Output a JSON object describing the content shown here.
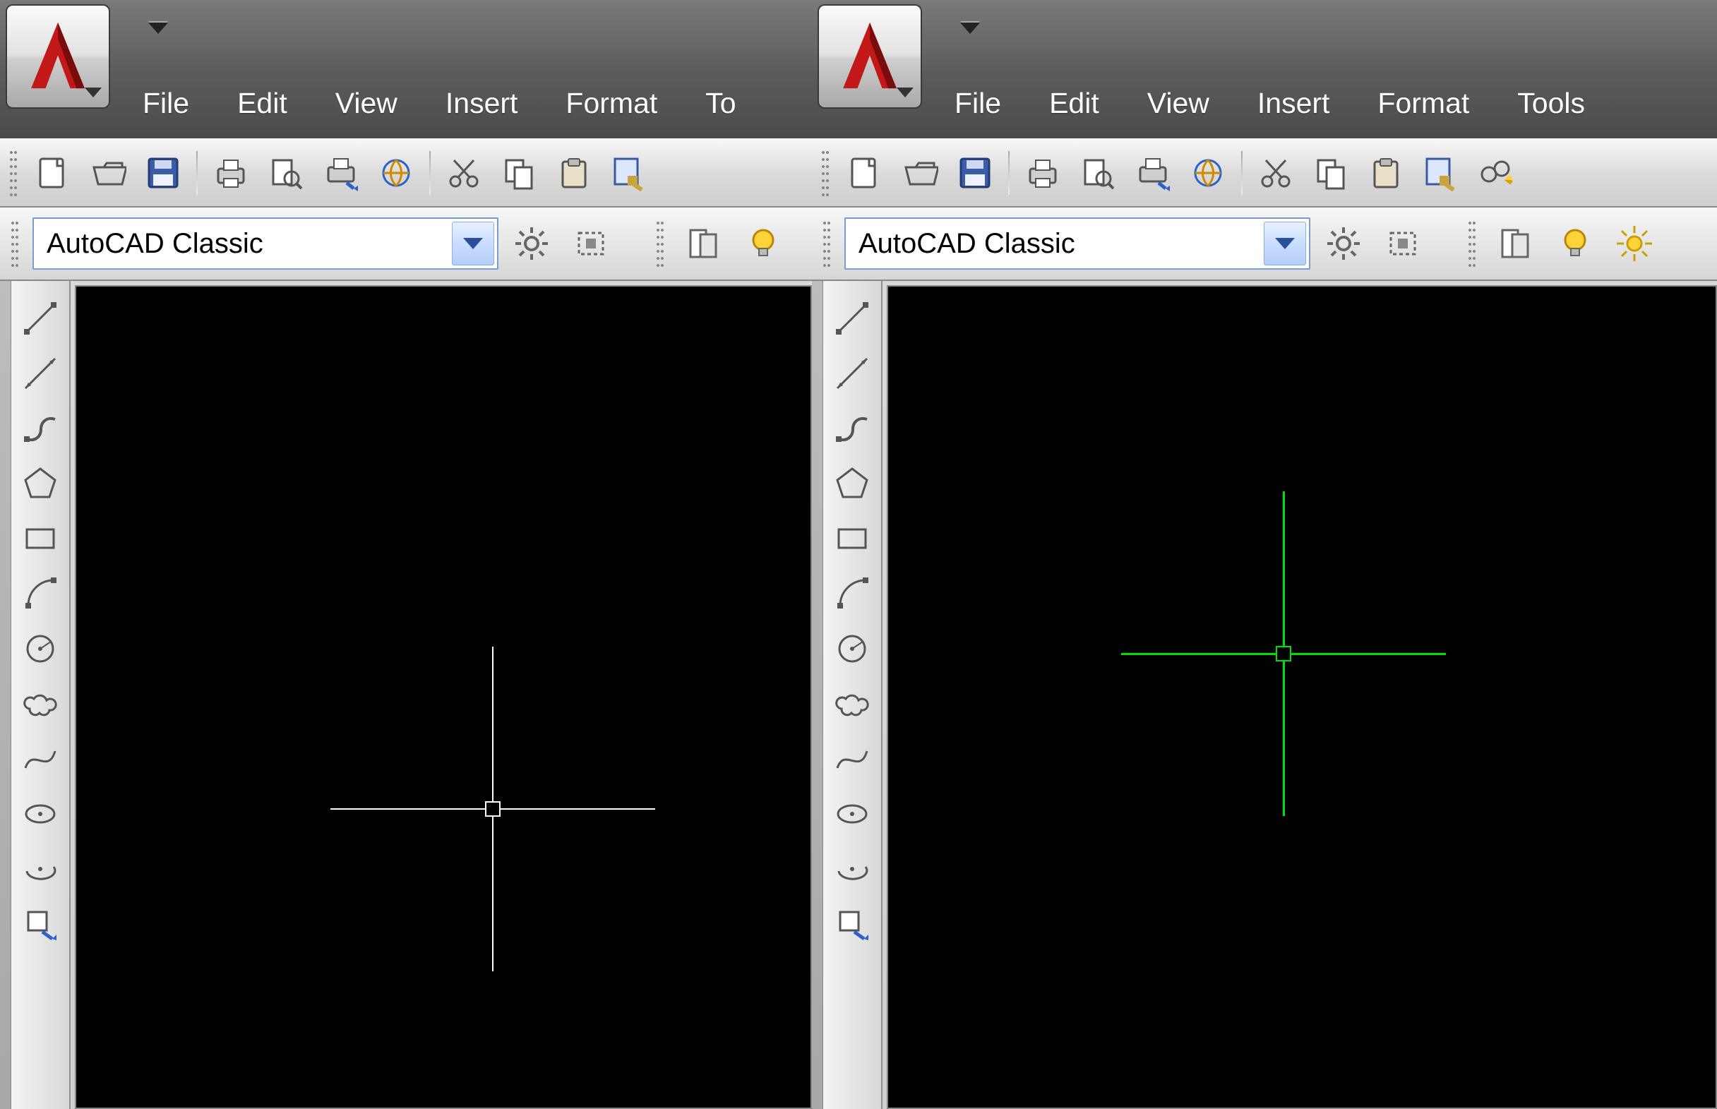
{
  "left": {
    "menus": [
      "File",
      "Edit",
      "View",
      "Insert",
      "Format",
      "To"
    ],
    "workspace": "AutoCAD Classic",
    "crosshair_color": "#ffffff"
  },
  "right": {
    "menus": [
      "File",
      "Edit",
      "View",
      "Insert",
      "Format",
      "Tools"
    ],
    "workspace": "AutoCAD Classic",
    "crosshair_color": "#00e000"
  },
  "toolbar_icons": [
    "new",
    "open",
    "save",
    "sep",
    "print",
    "print-preview",
    "plot",
    "publish",
    "sep",
    "cut",
    "copy",
    "paste",
    "match-properties",
    "sep-partial"
  ],
  "toolbar_icons_right_extra": [
    "block"
  ],
  "ws_icons": [
    "settings",
    "workspace-lock"
  ],
  "ws_icons_2": [
    "tool-palettes",
    "lightbulb"
  ],
  "ws_icons_2_right_extra": [
    "sun"
  ],
  "draw_tools": [
    "line",
    "construction-line",
    "polyline",
    "polygon",
    "rectangle",
    "arc",
    "circle",
    "revision-cloud",
    "spline",
    "ellipse",
    "ellipse-arc",
    "insert-block"
  ]
}
